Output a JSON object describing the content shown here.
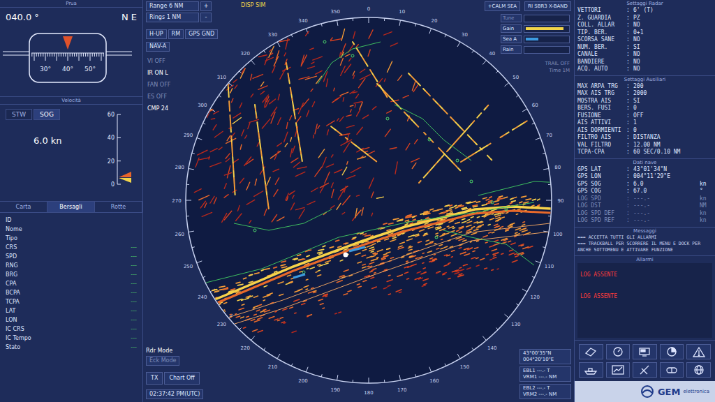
{
  "heading_panel": {
    "title": "Prua",
    "value": "040.0 °",
    "cardinal": "N E",
    "scale": [
      "30°",
      "40°",
      "50°"
    ]
  },
  "speed_panel": {
    "title": "Velocità",
    "tabs": [
      {
        "label": "STW",
        "selected": false
      },
      {
        "label": "SOG",
        "selected": true
      }
    ],
    "value": "6.0 kn",
    "scale": [
      "60",
      "40",
      "20",
      "0"
    ],
    "level": 0.1
  },
  "target_tabs": [
    {
      "label": "Carta",
      "selected": false
    },
    {
      "label": "Bersagli",
      "selected": true
    },
    {
      "label": "Rotte",
      "selected": false
    }
  ],
  "target_fields": [
    {
      "label": "ID",
      "value": ""
    },
    {
      "label": "Nome",
      "value": ""
    },
    {
      "label": "Tipo",
      "value": ""
    },
    {
      "label": "CRS",
      "value": "---"
    },
    {
      "label": "SPD",
      "value": "---"
    },
    {
      "label": "RNG",
      "value": "---"
    },
    {
      "label": "BRG",
      "value": "---"
    },
    {
      "label": "CPA",
      "value": "---"
    },
    {
      "label": "BCPA",
      "value": "---"
    },
    {
      "label": "TCPA",
      "value": "---"
    },
    {
      "label": "LAT",
      "value": "---"
    },
    {
      "label": "LON",
      "value": "---"
    },
    {
      "label": "IC CRS",
      "value": "---"
    },
    {
      "label": "IC Tempo",
      "value": "---"
    },
    {
      "label": "Stato",
      "value": "---"
    }
  ],
  "radar_top": {
    "range": "Range  6 NM",
    "rings": "Rings  1 NM",
    "range_button": "+",
    "rings_button": "-",
    "display": "DISP SIM",
    "sea": "+CALM SEA",
    "radar": "RI SBR3 X-BAND"
  },
  "mode_row": [
    "H-UP",
    "RM",
    "GPS GND"
  ],
  "nav_mode": "NAV-A",
  "options": [
    {
      "label": "VI OFF",
      "disabled": true
    },
    {
      "label": "IR ON L",
      "disabled": false
    },
    {
      "label": "FAN OFF",
      "disabled": true
    },
    {
      "label": "ES OFF",
      "disabled": true
    },
    {
      "label": "CMP 24",
      "disabled": false
    }
  ],
  "controls": [
    {
      "label": "Tune",
      "level": 0,
      "color": "#f2d54a",
      "disabled": true
    },
    {
      "label": "Gain",
      "level": 0.9,
      "color": "#f2d54a",
      "disabled": false
    },
    {
      "label": "Sea A",
      "level": 0.3,
      "color": "#3d9be0",
      "disabled": false
    },
    {
      "label": "Rain",
      "level": 0,
      "color": "#3d9be0",
      "disabled": false
    }
  ],
  "trail": {
    "label": "TRAIL OFF",
    "time": "Time 1M",
    "disabled": true
  },
  "bearings": [
    "0",
    "10",
    "20",
    "30",
    "40",
    "50",
    "60",
    "70",
    "80",
    "90",
    "100",
    "110",
    "120",
    "130",
    "140",
    "150",
    "160",
    "170",
    "180",
    "190",
    "200",
    "210",
    "220",
    "230",
    "240",
    "250",
    "260",
    "270",
    "280",
    "290",
    "300",
    "310",
    "320",
    "330",
    "340",
    "350"
  ],
  "cursor": {
    "lat": "43°00'35\"N",
    "lon": "004°20'10\"E"
  },
  "ebl_vrm": [
    {
      "ebl": "EBL1 ---.- T",
      "vrm": "VRM1 ---.- NM"
    },
    {
      "ebl": "EBL2 ---.- T",
      "vrm": "VRM2 ---.- NM"
    }
  ],
  "bottom_left": {
    "rdr_mode": "Rdr Mode",
    "eck_mode": "Eck Mode",
    "eck_disabled": true,
    "tx": "TX",
    "chart": "Chart Off",
    "clock": "02:37:42 PM(UTC)"
  },
  "separator": ":",
  "settings": [
    {
      "title": "Settaggi Radar",
      "rows": [
        {
          "label": "VETTORI",
          "value": "6' (T)"
        },
        {
          "label": "Z. GUARDIA",
          "value": "PZ"
        },
        {
          "label": "COLL. ALLAR",
          "value": "NO"
        },
        {
          "label": "TIP. BER.",
          "value": "0+1"
        },
        {
          "label": "SCORSA SANE",
          "value": "NO"
        },
        {
          "label": "NUM. BER.",
          "value": "SI"
        },
        {
          "label": "CANALE",
          "value": "NO"
        },
        {
          "label": "BANDIERE",
          "value": "NO"
        },
        {
          "label": "ACQ. AUTO",
          "value": "NO"
        }
      ]
    },
    {
      "title": "Settaggi Ausiliari",
      "rows": [
        {
          "label": "MAX ARPA TRG",
          "value": "200"
        },
        {
          "label": "MAX AIS TRG",
          "value": "2000"
        },
        {
          "label": "MOSTRA AIS",
          "value": "SI"
        },
        {
          "label": "BERS. FUSI",
          "value": "0"
        },
        {
          "label": "FUSIONE",
          "value": "OFF"
        },
        {
          "label": "AIS ATTIVI",
          "value": "1"
        },
        {
          "label": "AIS DORMIENTI",
          "value": "0"
        },
        {
          "label": "FILTRO AIS",
          "value": "DISTANZA"
        },
        {
          "label": "VAL FILTRO",
          "value": "12.00 NM"
        },
        {
          "label": "TCPA-CPA",
          "value": "60 SEC/0.10 NM"
        }
      ]
    }
  ],
  "ownship": {
    "title": "Dati nave",
    "rows": [
      {
        "label": "GPS LAT",
        "value": "43°01'34\"N",
        "unit": "",
        "disabled": false
      },
      {
        "label": "GPS LON",
        "value": "004°11'29\"E",
        "unit": "",
        "disabled": false
      },
      {
        "label": "GPS SOG",
        "value": "6.0",
        "unit": "kn",
        "disabled": false
      },
      {
        "label": "GPS COG",
        "value": "67.0",
        "unit": "°",
        "disabled": false
      },
      {
        "label": "LOG SPD",
        "value": "---.-",
        "unit": "kn",
        "disabled": true
      },
      {
        "label": "LOG DST",
        "value": "---.-",
        "unit": "NM",
        "disabled": true
      },
      {
        "label": "LOG SPD DEF",
        "value": "---.-",
        "unit": "kn",
        "disabled": true
      },
      {
        "label": "LOG SPD REF",
        "value": "---.-",
        "unit": "kn",
        "disabled": true
      }
    ]
  },
  "messages": {
    "title": "Messaggi",
    "lines": [
      "=== ACCETTA TUTTI GLI ALLARMI",
      "=== TRACKBALL PER SCORRERE IL MENU E DOCK PER",
      "ANCHE SOTTOMENU E ATTIVARE FUNZIONE"
    ]
  },
  "alarms": {
    "title": "Allarmi",
    "items": [
      "LOG ASSENTE",
      "LOG ASSENTE"
    ]
  },
  "logo": {
    "name": "GEM",
    "sub": "elettronica"
  }
}
